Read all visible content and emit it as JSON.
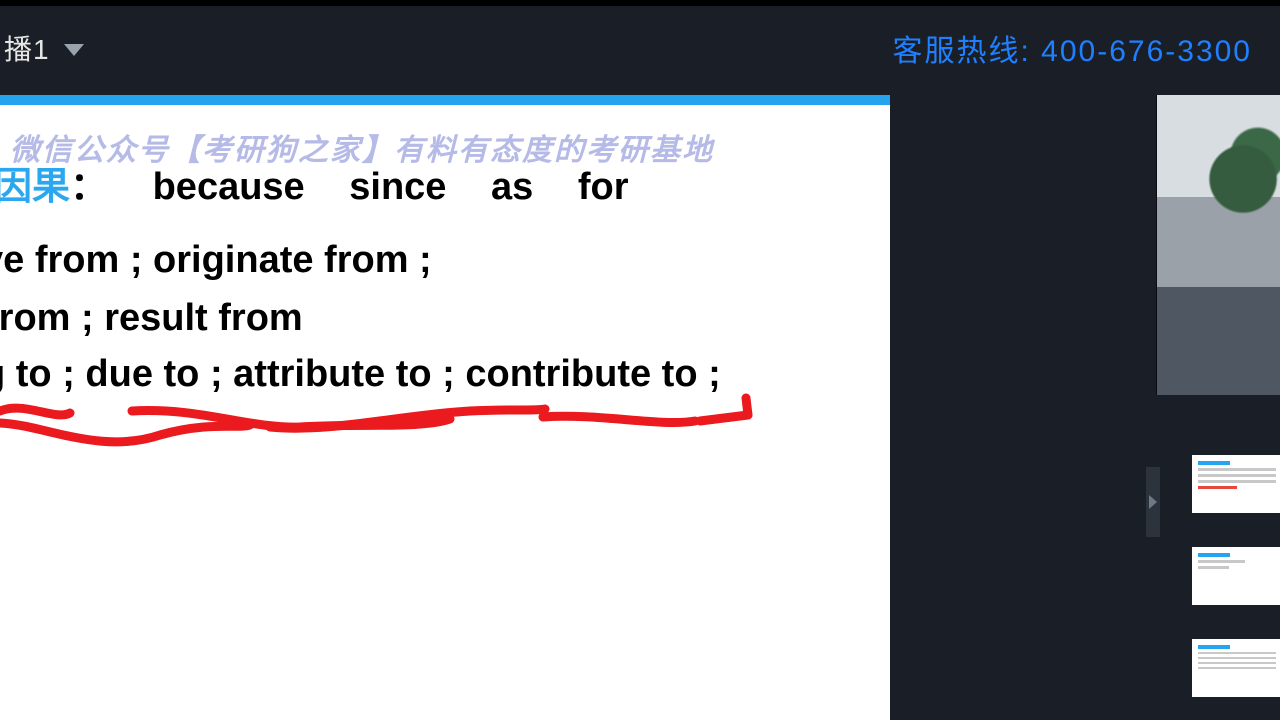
{
  "topbar": {
    "channel_label": "播1",
    "hotline": "客服热线: 400-676-3300"
  },
  "slide": {
    "watermark": "微信公众号【考研狗之家】有料有态度的考研基地",
    "heading_accent": "因果",
    "heading_colon": "：",
    "heading_words": [
      "because",
      "since",
      "as",
      "for"
    ],
    "line2": "ve  from  ;  originate  from   ;",
    "line3": " from    ;  result from",
    "line4": "g to  ;  due to  ; attribute to  ; contribute  to   ;"
  }
}
